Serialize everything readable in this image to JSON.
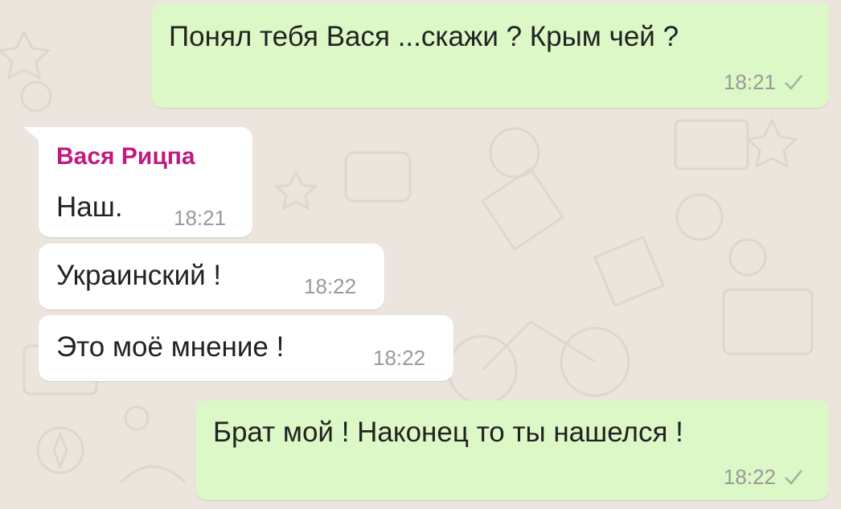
{
  "colors": {
    "outgoing_bubble": "#dcf8c6",
    "incoming_bubble": "#ffffff",
    "sender_name": "#c2187f",
    "wallpaper": "#ece5dd",
    "timestamp": "#9a9a9a",
    "check": "#9fb39a"
  },
  "messages": [
    {
      "direction": "outgoing",
      "text": "Понял тебя Вася ...скажи ? Крым чей ?",
      "time": "18:21",
      "status_icon": "single-check-icon"
    },
    {
      "direction": "incoming",
      "sender": "Вася Рицпа",
      "text": "Наш.",
      "time": "18:21"
    },
    {
      "direction": "incoming",
      "text": "Украинский !",
      "time": "18:22"
    },
    {
      "direction": "incoming",
      "text": "Это моё мнение !",
      "time": "18:22"
    },
    {
      "direction": "outgoing",
      "text": "Брат мой ! Наконец то ты нашелся !",
      "time": "18:22",
      "status_icon": "single-check-icon"
    }
  ]
}
